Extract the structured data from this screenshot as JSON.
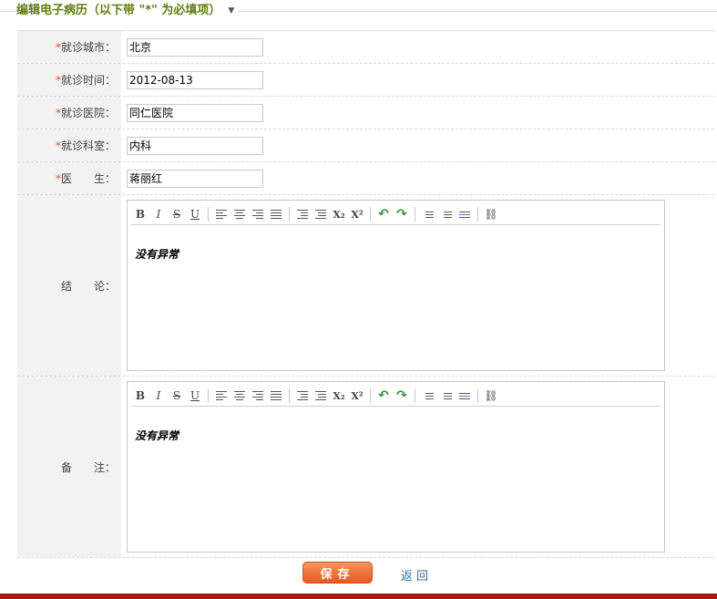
{
  "section": {
    "title": "编辑电子病历（以下带 \"*\" 为必填项）"
  },
  "fields": [
    {
      "label": "就诊城市：",
      "value": "北京",
      "required": true
    },
    {
      "label": "就诊时间：",
      "value": "2012-08-13",
      "required": true
    },
    {
      "label": "就诊医院：",
      "value": "同仁医院",
      "required": true
    },
    {
      "label": "就诊科室：",
      "value": "内科",
      "required": true
    },
    {
      "label": "医　　生：",
      "value": "蒋丽红",
      "required": true
    }
  ],
  "required_mark": "*",
  "editors": [
    {
      "label": "结　　论：",
      "content": "没有异常"
    },
    {
      "label": "备　　注：",
      "content": "没有异常"
    }
  ],
  "toolbar": {
    "bold": "B",
    "italic": "I",
    "strike": "S",
    "underline": "U",
    "subscript": "X₂",
    "superscript": "X²"
  },
  "actions": {
    "save_label": "保存",
    "back_label": "返回"
  },
  "colors": {
    "accent": "#5f7d12",
    "required": "#e4551b",
    "button": "#e45a20",
    "footer": "#a41b12"
  }
}
